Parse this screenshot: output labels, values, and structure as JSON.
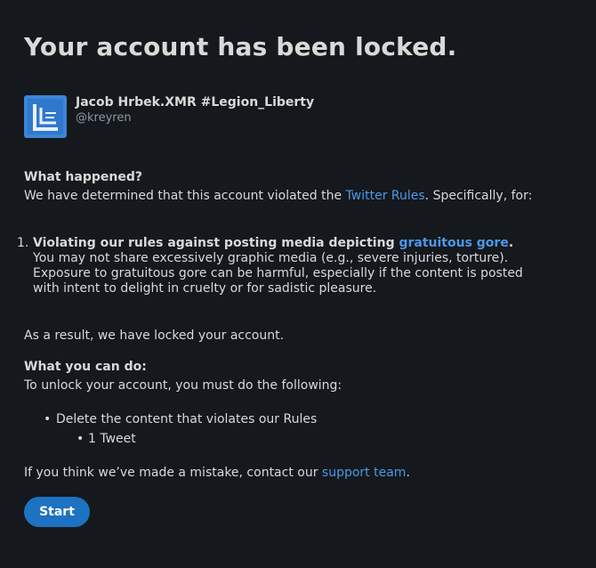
{
  "page": {
    "title": "Your account has been locked."
  },
  "profile": {
    "display_name": "Jacob Hrbek.XMR #Legion_Liberty",
    "handle": "@kreyren"
  },
  "what_happened": {
    "heading": "What happened?",
    "text_before": "We have determined that this account violated the ",
    "link": "Twitter Rules",
    "text_after": ". Specifically, for:"
  },
  "violations": [
    {
      "number": "1.",
      "title_before": "Violating our rules against posting media depicting ",
      "title_link": "gratuitous gore",
      "title_after": ".",
      "description": "You may not share excessively graphic media (e.g., severe injuries, torture). Exposure to gratuitous gore can be harmful, especially if the content is posted with intent to delight in cruelty or for sadistic pleasure."
    }
  ],
  "result_text": "As a result, we have locked your account.",
  "what_you_can_do": {
    "heading": "What you can do:",
    "intro": "To unlock your account, you must do the following:",
    "task": "Delete the content that violates our Rules",
    "subtask": "1 Tweet"
  },
  "mistake": {
    "text_before": "If you think we’ve made a mistake, contact our ",
    "link": "support team",
    "text_after": "."
  },
  "start_button": {
    "label": "Start"
  },
  "colors": {
    "background": "#15181c",
    "link": "#4a99e9",
    "button": "#1d72c1"
  }
}
